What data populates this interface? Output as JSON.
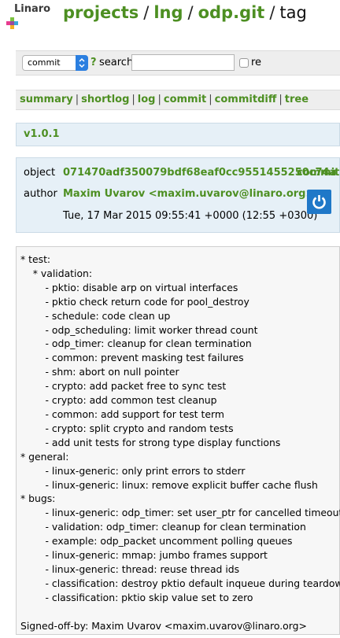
{
  "logo": {
    "text": "Linaro"
  },
  "breadcrumb": {
    "projects": "projects",
    "lng": "lng",
    "repo": "odp.git",
    "page": "tag",
    "separator": "/"
  },
  "search": {
    "type_selected": "commit",
    "help": "?",
    "label": "search:",
    "value": "",
    "regex_label": "re"
  },
  "nav": {
    "summary": "summary",
    "shortlog": "shortlog",
    "log": "log",
    "commit": "commit",
    "commitdiff": "commitdiff",
    "tree": "tree",
    "separator": "|"
  },
  "tag": {
    "name": "v1.0.1",
    "object_label": "object",
    "object_hash": "071470adf350079bdf68eaf0cc9551455250c74a",
    "object_link": "commit",
    "author_label": "author",
    "author": "Maxim Uvarov <maxim.uvarov@linaro.org>",
    "date": "Tue, 17 Mar 2015 09:55:41 +0000 (12:55 +0300)"
  },
  "colors": {
    "link": "#4d8f22",
    "bar_bg": "#eeeeee",
    "tag_bg": "#e6f0f7",
    "avatar": "#1f78c8"
  },
  "message_lines": [
    "* test:",
    "    * validation:",
    "        - pktio: disable arp on virtual interfaces",
    "        - pktio check return code for pool_destroy",
    "        - schedule: code clean up",
    "        - odp_scheduling: limit worker thread count",
    "        - odp_timer: cleanup for clean termination",
    "        - common: prevent masking test failures",
    "        - shm: abort on null pointer",
    "        - crypto: add packet free to sync test",
    "        - crypto: add common test cleanup",
    "        - common: add support for test term",
    "        - crypto: split crypto and random tests",
    "        - add unit tests for strong type display functions",
    "* general:",
    "        - linux-generic: only print errors to stderr",
    "        - linux-generic: linux: remove explicit buffer cache flush",
    "* bugs:",
    "        - linux-generic: odp_timer: set user_ptr for cancelled timeout",
    "        - validation: odp_timer: cleanup for clean termination",
    "        - example: odp_packet uncomment polling queues",
    "        - linux-generic: mmap: jumbo frames support",
    "        - linux-generic: thread: reuse thread ids",
    "        - classification: destroy pktio default inqueue during teardown",
    "        - classification: pktio skip value set to zero",
    "",
    "Signed-off-by: Maxim Uvarov <maxim.uvarov@linaro.org>"
  ]
}
